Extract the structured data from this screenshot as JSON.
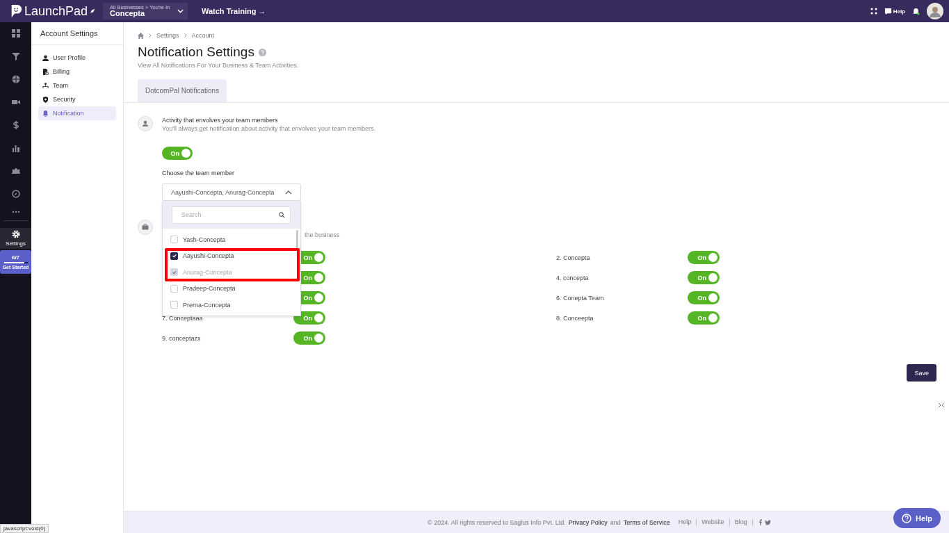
{
  "topbar": {
    "brand": "LaunchPad",
    "business": {
      "caption": "All Businesses > You're In",
      "name": "Concepta"
    },
    "watch_training": "Watch Training →",
    "help": "Help"
  },
  "rail": {
    "settings": {
      "label": "Settings",
      "selected": true
    },
    "progress": {
      "count": "6/7",
      "level": 0.86,
      "label": "Get Started"
    }
  },
  "account_menu": {
    "title": "Account Settings",
    "items": [
      {
        "kind": "user",
        "label": "User Profile",
        "selected": false
      },
      {
        "kind": "billing",
        "label": "Billing",
        "selected": false
      },
      {
        "kind": "team",
        "label": "Team",
        "selected": false
      },
      {
        "kind": "security",
        "label": "Security",
        "selected": false
      },
      {
        "kind": "bell",
        "label": "Notification",
        "selected": true
      }
    ]
  },
  "breadcrumb": [
    "Settings",
    "Account"
  ],
  "page": {
    "title": "Notification Settings",
    "subtitle": "View All Notifications For Your Business & Team Activities."
  },
  "tabs": [
    {
      "label": "DotcomPal Notifications",
      "selected": true
    }
  ],
  "activity": {
    "title": "Activity that envolves your team members",
    "description": "You'll always get notification about activity that envolves your team members.",
    "toggle": {
      "on": true,
      "label": "On"
    },
    "choose_label": "Choose the team member",
    "select": {
      "value": "Aayushi-Concepta, Anurag-Concepta",
      "expanded": true,
      "search_placeholder": "Search",
      "options": [
        {
          "label": "Yash-Concepta",
          "checked": false,
          "disabled": false
        },
        {
          "label": "Aayushi-Concepta",
          "checked": true,
          "disabled": false
        },
        {
          "label": "Anurag-Concepta",
          "checked": true,
          "disabled": true
        },
        {
          "label": "Pradeep-Concepta",
          "checked": false,
          "disabled": false
        },
        {
          "label": "Prerna-Concepta",
          "checked": false,
          "disabled": false
        }
      ]
    }
  },
  "business": {
    "description": "the business",
    "toggles": [
      {
        "on": true,
        "label": "On"
      },
      {
        "name": "2. Concepta",
        "on": true,
        "label": "On"
      },
      {
        "on": true,
        "label": "On"
      },
      {
        "name": "4. concepta",
        "on": true,
        "label": "On"
      },
      {
        "on": true,
        "label": "On"
      },
      {
        "name": "6. Conepta Team",
        "on": true,
        "label": "On"
      },
      {
        "name": "7. Conceptaaa",
        "on": true,
        "label": "On"
      },
      {
        "name": "8. Conceepta",
        "on": true,
        "label": "On"
      },
      {
        "name": "9. conceptazx",
        "on": true,
        "label": "On"
      }
    ]
  },
  "save": "Save",
  "footer": {
    "copyright": "©  2024. All rights reserved to Saglus Info Pvt. Ltd.",
    "privacy": "Privacy Policy",
    "and": "and",
    "terms": "Terms of Service",
    "links": [
      "Help",
      "Website",
      "Blog"
    ]
  },
  "help_button": "Help",
  "status_url": "javascript:void(0)"
}
